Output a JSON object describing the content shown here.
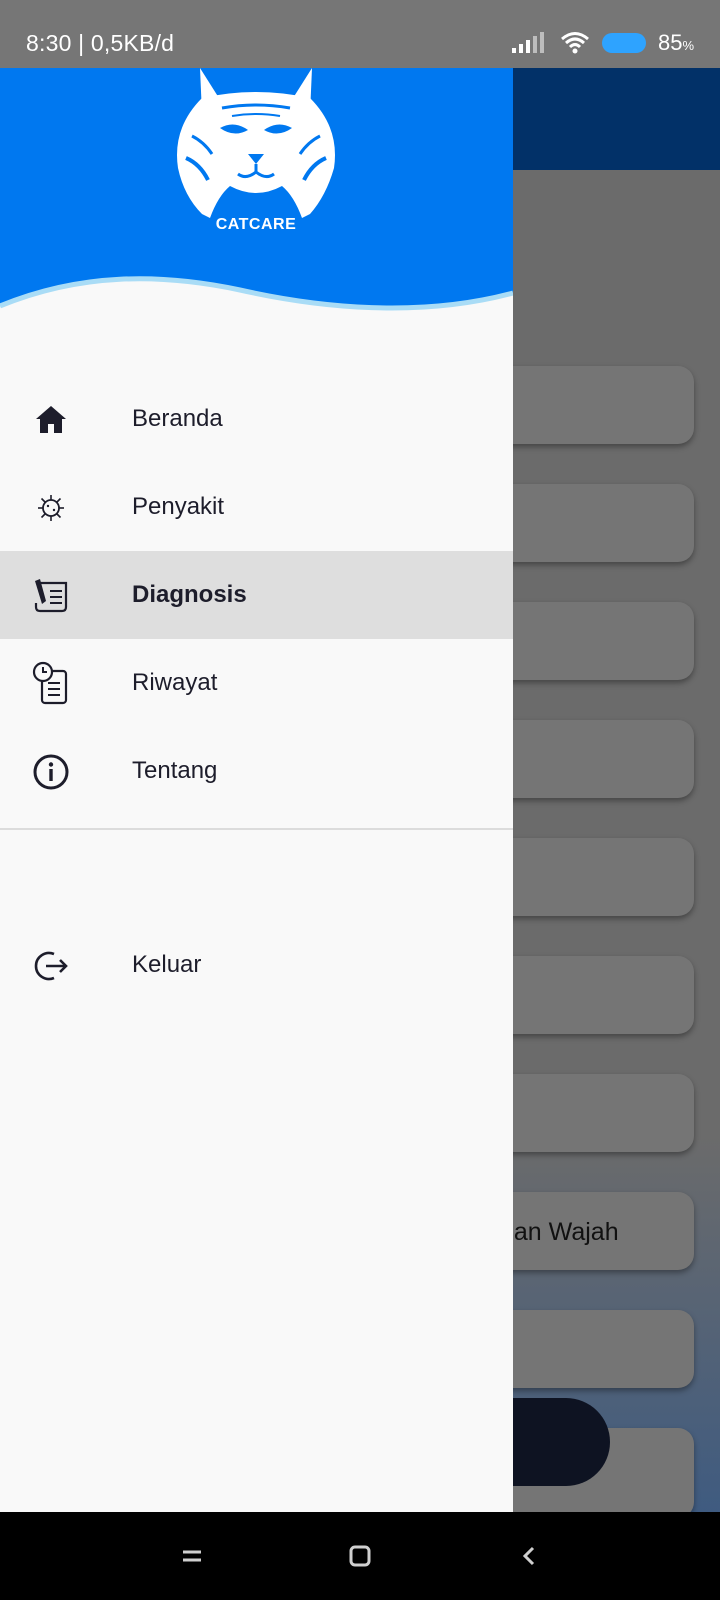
{
  "status_bar": {
    "time": "8:30 | 0,5KB/d",
    "battery_level": "85",
    "battery_unit": "%",
    "battery_color": "#2ea3ff"
  },
  "background": {
    "header_color": "#023168",
    "visible_card_text": "dan Wajah"
  },
  "drawer": {
    "brand": "CATCARE",
    "header_color": "#0078f0",
    "menu": [
      {
        "label": "Beranda",
        "icon": "home-icon"
      },
      {
        "label": "Penyakit",
        "icon": "virus-icon"
      },
      {
        "label": "Diagnosis",
        "icon": "diagnosis-icon",
        "active": true
      },
      {
        "label": "Riwayat",
        "icon": "history-icon"
      },
      {
        "label": "Tentang",
        "icon": "info-icon"
      }
    ],
    "logout": {
      "label": "Keluar",
      "icon": "logout-icon"
    }
  },
  "nav_bar": {
    "buttons": [
      "menu-icon",
      "home-icon",
      "back-icon"
    ]
  }
}
